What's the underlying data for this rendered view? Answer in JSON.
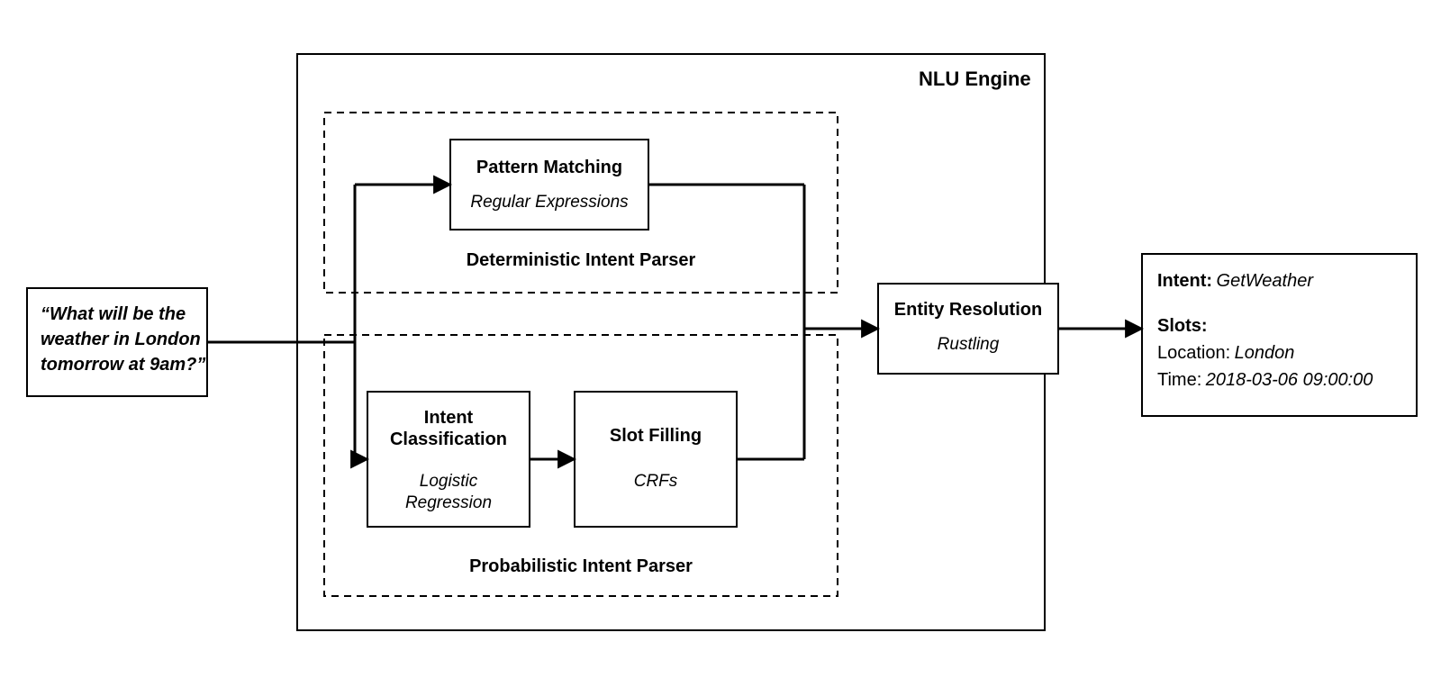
{
  "input": {
    "line1": "“What will be the",
    "line2": "weather in London",
    "line3": "tomorrow at 9am?”"
  },
  "engine": {
    "title": "NLU Engine"
  },
  "deterministic": {
    "caption": "Deterministic Intent Parser",
    "pattern": {
      "title": "Pattern Matching",
      "sub": "Regular Expressions"
    }
  },
  "probabilistic": {
    "caption": "Probabilistic Intent Parser",
    "intent": {
      "title_l1": "Intent",
      "title_l2": "Classification",
      "sub_l1": "Logistic",
      "sub_l2": "Regression"
    },
    "slot": {
      "title": "Slot Filling",
      "sub": "CRFs"
    }
  },
  "entity": {
    "title": "Entity Resolution",
    "sub": "Rustling"
  },
  "output": {
    "intent_label": "Intent:",
    "intent_value": "GetWeather",
    "slots_label": "Slots:",
    "location_label": "Location:",
    "location_value": "London",
    "time_label": "Time:",
    "time_value": "2018-03-06 09:00:00"
  }
}
